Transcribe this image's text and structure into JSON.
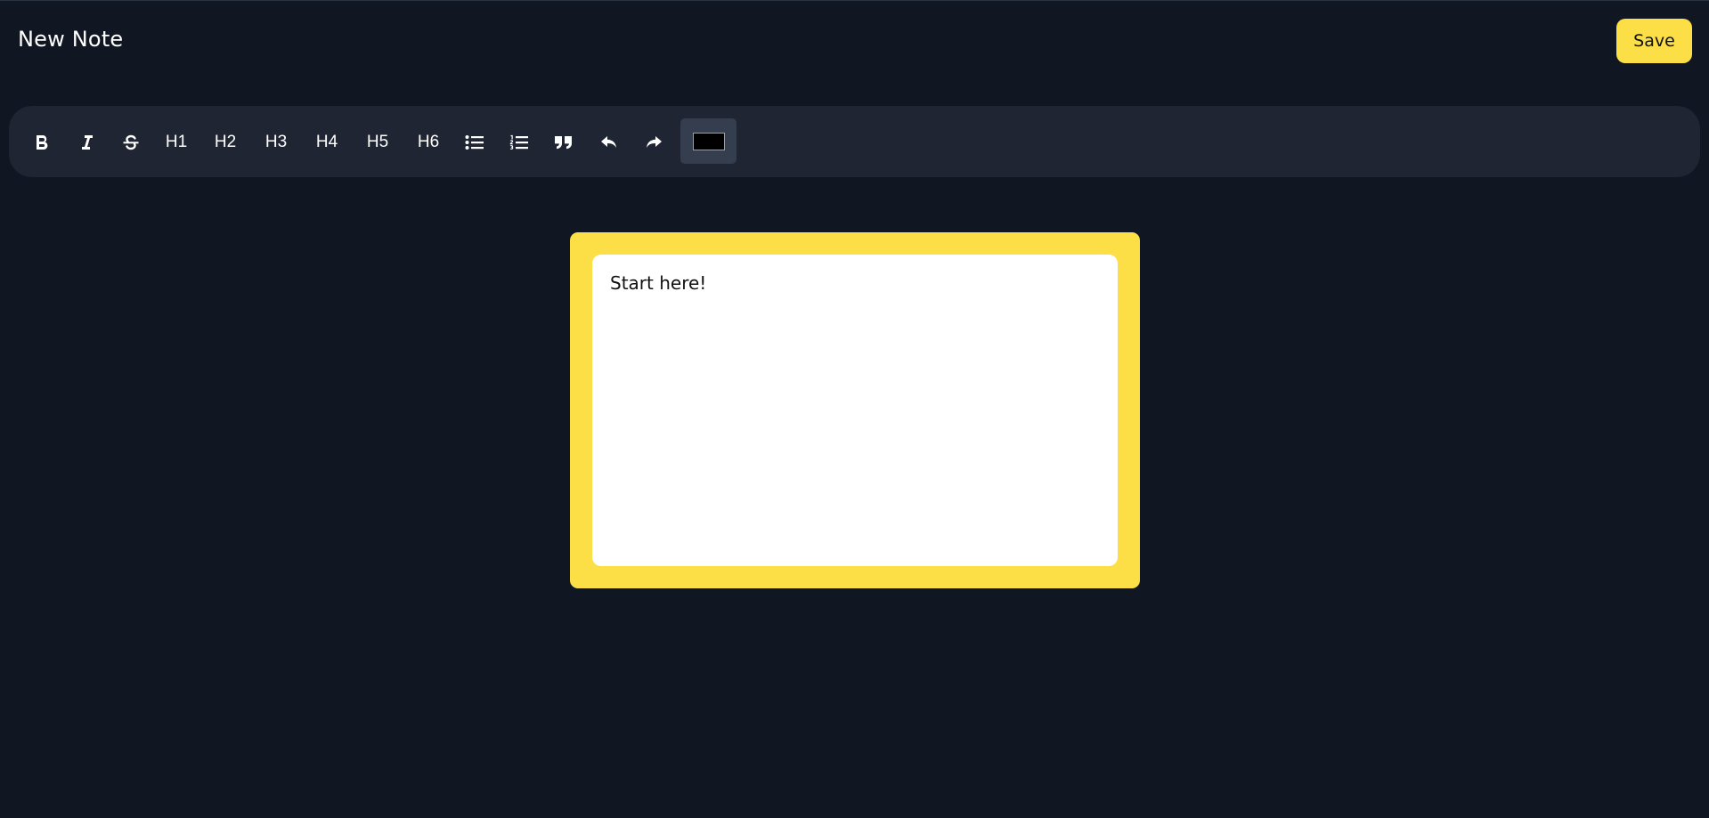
{
  "header": {
    "title": "New Note",
    "save_label": "Save"
  },
  "toolbar": {
    "buttons": [
      {
        "name": "bold",
        "icon": "bold-icon"
      },
      {
        "name": "italic",
        "icon": "italic-icon"
      },
      {
        "name": "strikethrough",
        "icon": "strikethrough-icon"
      },
      {
        "name": "h1",
        "label": "H1"
      },
      {
        "name": "h2",
        "label": "H2"
      },
      {
        "name": "h3",
        "label": "H3"
      },
      {
        "name": "h4",
        "label": "H4"
      },
      {
        "name": "h5",
        "label": "H5"
      },
      {
        "name": "h6",
        "label": "H6"
      },
      {
        "name": "bullet-list",
        "icon": "bullet-list-icon"
      },
      {
        "name": "ordered-list",
        "icon": "ordered-list-icon"
      },
      {
        "name": "blockquote",
        "icon": "quote-icon"
      },
      {
        "name": "undo",
        "icon": "undo-icon"
      },
      {
        "name": "redo",
        "icon": "redo-icon"
      }
    ],
    "text_color": "#000000"
  },
  "editor": {
    "content": "Start here!"
  },
  "colors": {
    "background": "#101722",
    "toolbar": "#1f2532",
    "accent": "#fcde46",
    "editor_bg": "#ffffff"
  }
}
